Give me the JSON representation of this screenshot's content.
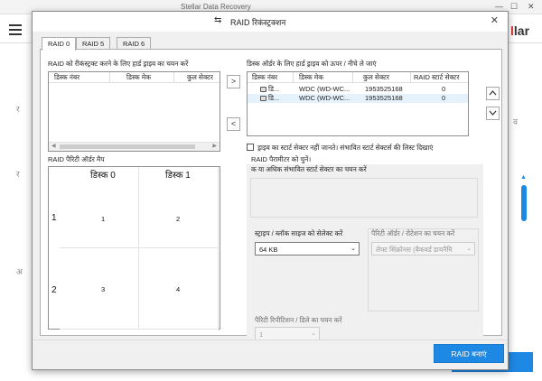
{
  "background": {
    "title": "Stellar Data Recovery",
    "logo_text": "llar"
  },
  "dialog": {
    "title": "RAID रिकंस्ट्रक्शन",
    "icon": "swap-arrows-icon",
    "close_icon": "close-icon"
  },
  "tabs": [
    {
      "label": "RAID 0",
      "active": true
    },
    {
      "label": "RAID 5",
      "active": false
    },
    {
      "label": "RAID 6",
      "active": false
    }
  ],
  "left_panel": {
    "label": "RAID को रीकंस्ट्रक्ट करने के लिए हार्ड ड्राइव का चयन करें",
    "columns": [
      "डिस्क नंबर",
      "डिस्क मेक",
      "कुल सेक्टर"
    ]
  },
  "move_buttons": {
    "right": ">",
    "left": "<"
  },
  "right_panel": {
    "label": "डिस्क ऑर्डर के लिए हार्ड ड्राइव को ऊपर / नीचे ले जाएं",
    "columns": [
      "डिस्क नंबर",
      "डिस्क मेक",
      "कुल सेक्टर",
      "RAID स्टार्ट सेक्टर"
    ],
    "rows": [
      {
        "disk": "डि...",
        "make": "WDC (WD-WC...",
        "sectors": "1953525168",
        "start": "0"
      },
      {
        "disk": "डि...",
        "make": "WDC (WD-WC...",
        "sectors": "1953525168",
        "start": "0"
      }
    ]
  },
  "order_buttons": {
    "up": "^",
    "down": "v"
  },
  "checkbox": {
    "label": "ड्राइव का स्टार्ट सेक्टर नहीं जानते। संभावित स्टार्ट सेक्टर्स की लिस्ट दिखाएं",
    "checked": false
  },
  "parity_map": {
    "label": "RAID पैरिटी ऑर्डर मैप",
    "headers": [
      "डिस्क 0",
      "डिस्क 1"
    ],
    "row_labels": [
      "1",
      "2"
    ],
    "cells": [
      [
        "1",
        "2"
      ],
      [
        "3",
        "4"
      ]
    ]
  },
  "raid_params": {
    "label": "RAID पैरामीटर को चुनें।",
    "start_sector_label": "क या अधिक संभावित स्टार्ट सेक्टर का चयन करें",
    "stripe_label": "स्ट्राइप / ब्लॉक साइज को सेलेक्ट करें",
    "stripe_value": "64 KB",
    "parity_order_label": "पैरिटी ऑर्डर / रोटेशन का चयन करें",
    "parity_order_value": "लेफ्ट सिंक्रोनस (बैकवर्ड डायनैमि",
    "parity_repetition_label": "पैरिटी रिपीटिशन / डिले का चयन करें",
    "parity_repetition_value": "1"
  },
  "build_button": "RAID बनाएं"
}
